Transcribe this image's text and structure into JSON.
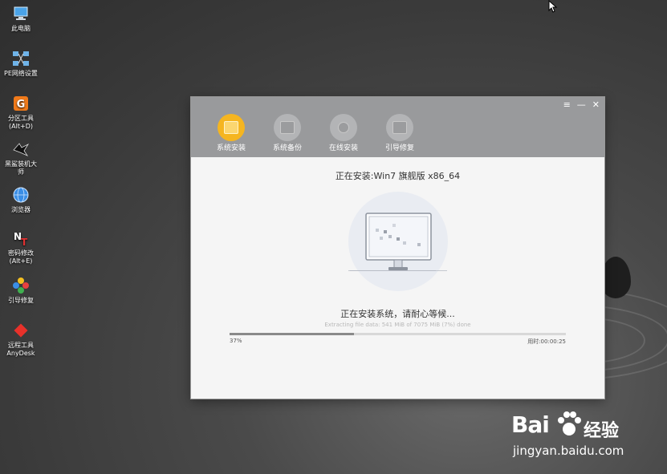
{
  "desktop": {
    "icons": [
      {
        "label": "此电脑",
        "icon": "computer-icon"
      },
      {
        "label": "PE网络设置",
        "icon": "network-icon"
      },
      {
        "label": "分区工具\n(Alt+D)",
        "icon": "partition-tool-icon"
      },
      {
        "label": "黑鲨装机大\n师",
        "icon": "blackshark-icon"
      },
      {
        "label": "浏览器",
        "icon": "browser-icon"
      },
      {
        "label": "密码修改\n(Alt+E)",
        "icon": "password-icon"
      },
      {
        "label": "引导修复",
        "icon": "boot-repair-icon"
      },
      {
        "label": "远程工具\nAnyDesk",
        "icon": "anydesk-icon"
      }
    ]
  },
  "window": {
    "controls": {
      "menu": "≡",
      "minimize": "—",
      "close": "✕"
    },
    "tabs": [
      {
        "label": "系统安装",
        "active": true
      },
      {
        "label": "系统备份",
        "active": false
      },
      {
        "label": "在线安装",
        "active": false
      },
      {
        "label": "引导修复",
        "active": false
      }
    ],
    "install_title": "正在安装:Win7 旗舰版 x86_64",
    "status_text": "正在安装系统，请耐心等候...",
    "detail_text": "Extracting file data: 541 MiB of 7075 MiB (7%) done",
    "progress": {
      "value": 0.37,
      "percent_label": "37%",
      "elapsed_label": "用时:00:00:25"
    }
  },
  "watermark": {
    "brand": "Bai",
    "brand_suffix": "经验",
    "url": "jingyan.baidu.com"
  },
  "colors": {
    "accent": "#f5b520",
    "header": "#999a9c",
    "background": "#f5f5f5"
  }
}
